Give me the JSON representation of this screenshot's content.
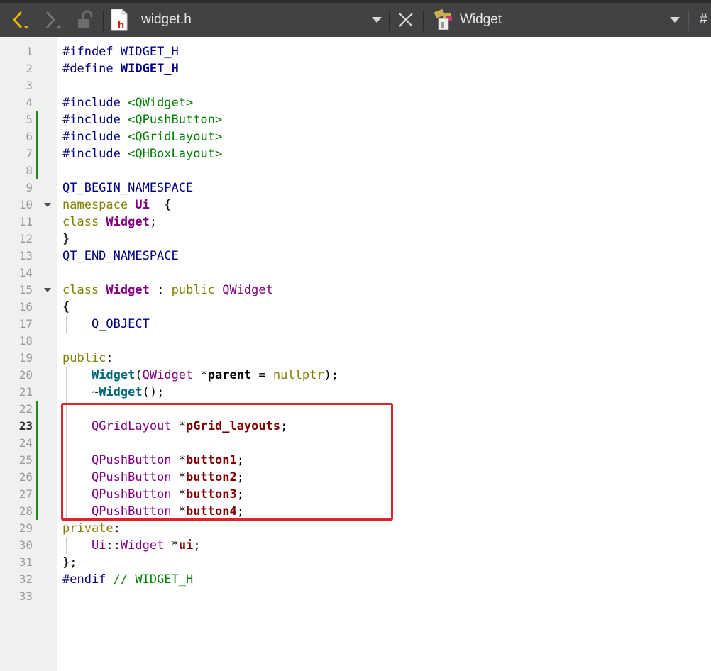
{
  "toolbar": {
    "file_name": "widget.h",
    "file_icon_letter": "h",
    "symbol_name": "Widget",
    "hash_label": "#"
  },
  "editor": {
    "current_line": 23,
    "line_numbers": [
      "1",
      "2",
      "3",
      "4",
      "5",
      "6",
      "7",
      "8",
      "9",
      "10",
      "11",
      "12",
      "13",
      "14",
      "15",
      "16",
      "17",
      "18",
      "19",
      "20",
      "21",
      "22",
      "23",
      "24",
      "25",
      "26",
      "27",
      "28",
      "29",
      "30",
      "31",
      "32",
      "33"
    ],
    "lines": [
      [
        [
          "pp",
          "#ifndef "
        ],
        [
          "mac",
          "WIDGET_H"
        ]
      ],
      [
        [
          "pp",
          "#define "
        ],
        [
          "mac bold",
          "WIDGET_H"
        ]
      ],
      [],
      [
        [
          "pp",
          "#include "
        ],
        [
          "inc",
          "<QWidget>"
        ]
      ],
      [
        [
          "pp",
          "#include "
        ],
        [
          "inc",
          "<QPushButton>"
        ]
      ],
      [
        [
          "pp",
          "#include "
        ],
        [
          "inc",
          "<QGridLayout>"
        ]
      ],
      [
        [
          "pp",
          "#include "
        ],
        [
          "inc",
          "<QHBoxLayout>"
        ]
      ],
      [],
      [
        [
          "mac",
          "QT_BEGIN_NAMESPACE"
        ]
      ],
      [
        [
          "kw",
          "namespace "
        ],
        [
          "typb",
          "Ui"
        ],
        [
          "",
          "  {"
        ]
      ],
      [
        [
          "kw",
          "class "
        ],
        [
          "typb",
          "Widget"
        ],
        [
          "",
          ";"
        ]
      ],
      [
        [
          "",
          "}"
        ]
      ],
      [
        [
          "mac",
          "QT_END_NAMESPACE"
        ]
      ],
      [],
      [
        [
          "kw",
          "class "
        ],
        [
          "typb",
          "Widget"
        ],
        [
          "",
          " : "
        ],
        [
          "kw",
          "public "
        ],
        [
          "typ",
          "QWidget"
        ]
      ],
      [
        [
          "",
          "{"
        ]
      ],
      [
        [
          "",
          "    "
        ],
        [
          "mac",
          "Q_OBJECT"
        ]
      ],
      [],
      [
        [
          "kw",
          "public"
        ],
        [
          "",
          ":"
        ]
      ],
      [
        [
          "",
          "    "
        ],
        [
          "fn",
          "Widget"
        ],
        [
          "",
          "("
        ],
        [
          "typ",
          "QWidget"
        ],
        [
          "",
          " *"
        ],
        [
          "bold",
          "parent"
        ],
        [
          "",
          " = "
        ],
        [
          "kw",
          "nullptr"
        ],
        [
          "",
          ");"
        ]
      ],
      [
        [
          "",
          "    ~"
        ],
        [
          "fn",
          "Widget"
        ],
        [
          "",
          "();"
        ]
      ],
      [],
      [
        [
          "",
          "    "
        ],
        [
          "typ",
          "QGridLayout"
        ],
        [
          "",
          " *"
        ],
        [
          "mem",
          "pGrid_layouts"
        ],
        [
          "",
          ";"
        ]
      ],
      [],
      [
        [
          "",
          "    "
        ],
        [
          "typ",
          "QPushButton"
        ],
        [
          "",
          " *"
        ],
        [
          "mem",
          "button1"
        ],
        [
          "",
          ";"
        ]
      ],
      [
        [
          "",
          "    "
        ],
        [
          "typ",
          "QPushButton"
        ],
        [
          "",
          " *"
        ],
        [
          "mem",
          "button2"
        ],
        [
          "",
          ";"
        ]
      ],
      [
        [
          "",
          "    "
        ],
        [
          "typ",
          "QPushButton"
        ],
        [
          "",
          " *"
        ],
        [
          "mem",
          "button3"
        ],
        [
          "",
          ";"
        ]
      ],
      [
        [
          "",
          "    "
        ],
        [
          "typ",
          "QPushButton"
        ],
        [
          "",
          " *"
        ],
        [
          "mem",
          "button4"
        ],
        [
          "",
          ";"
        ]
      ],
      [
        [
          "kw",
          "private"
        ],
        [
          "",
          ":"
        ]
      ],
      [
        [
          "",
          "    "
        ],
        [
          "typ",
          "Ui"
        ],
        [
          "",
          "::"
        ],
        [
          "typ",
          "Widget"
        ],
        [
          "",
          " *"
        ],
        [
          "mem",
          "ui"
        ],
        [
          "",
          ";"
        ]
      ],
      [
        [
          "",
          "};"
        ]
      ],
      [
        [
          "pp",
          "#endif "
        ],
        [
          "cmt",
          "// WIDGET_H"
        ]
      ],
      []
    ]
  }
}
